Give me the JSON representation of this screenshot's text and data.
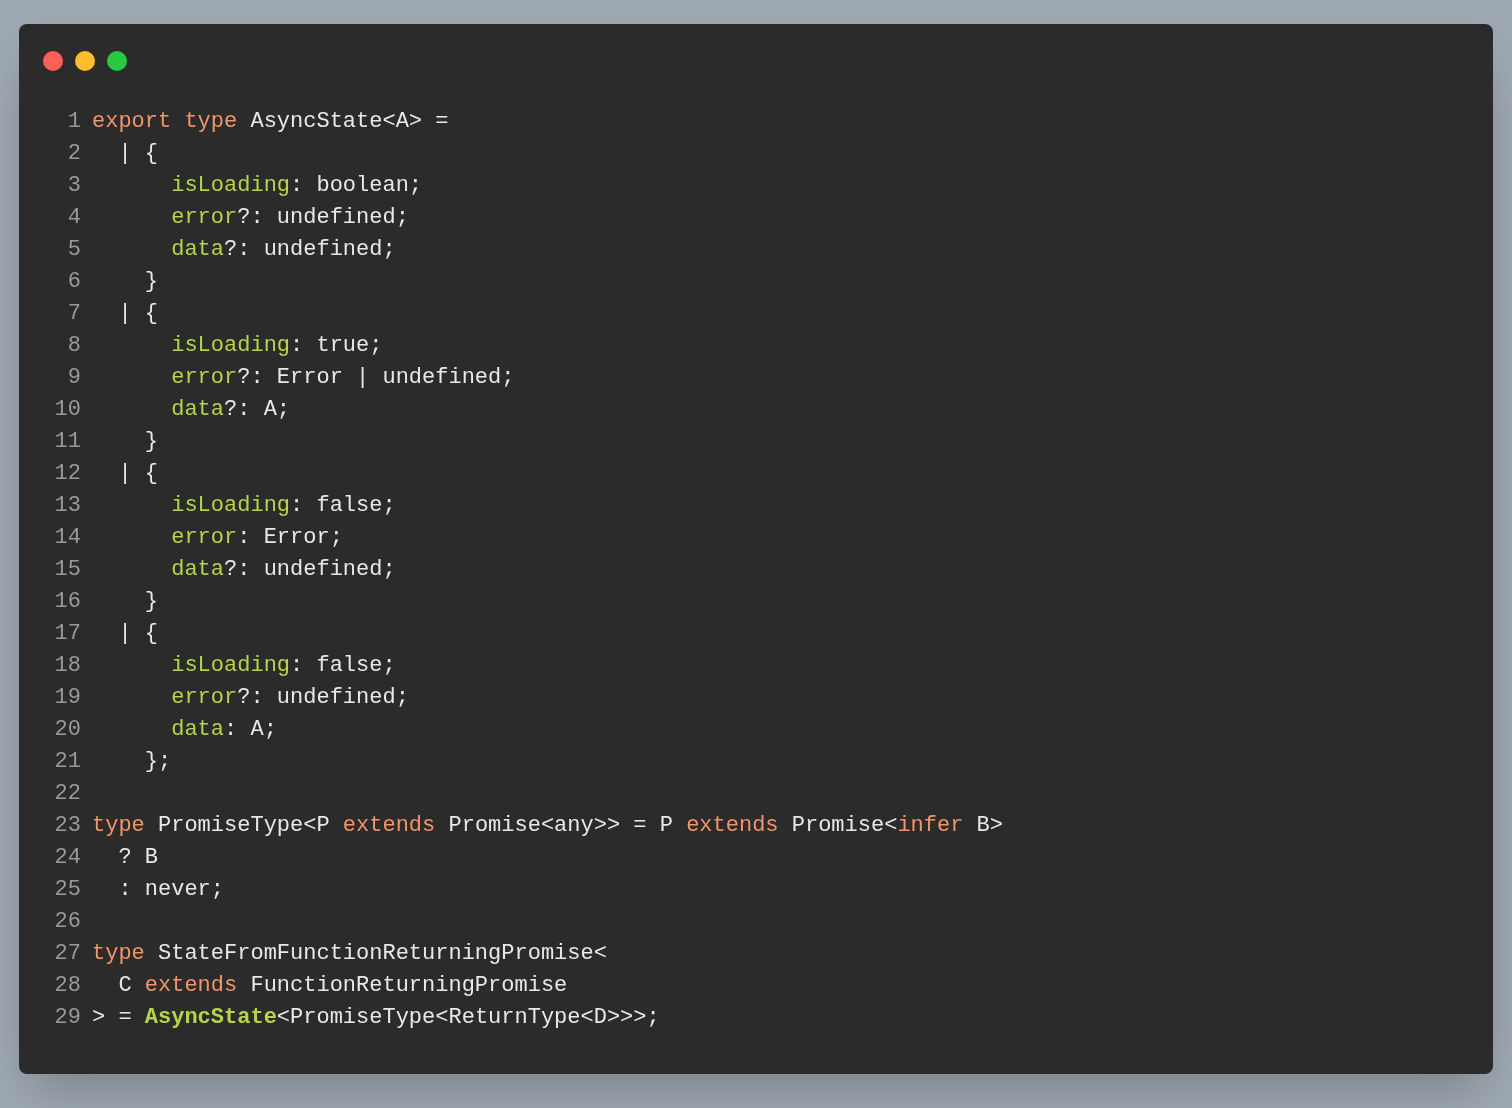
{
  "code": {
    "lines": [
      {
        "number": "1",
        "tokens": [
          {
            "kind": "keyword",
            "text": "export type"
          },
          {
            "kind": "plain",
            "text": " AsyncState<A> ="
          }
        ]
      },
      {
        "number": "2",
        "tokens": [
          {
            "kind": "plain",
            "text": "  | {"
          }
        ]
      },
      {
        "number": "3",
        "tokens": [
          {
            "kind": "property",
            "text": "      isLoading"
          },
          {
            "kind": "plain",
            "text": ": boolean;"
          }
        ]
      },
      {
        "number": "4",
        "tokens": [
          {
            "kind": "property",
            "text": "      error"
          },
          {
            "kind": "plain",
            "text": "?: undefined;"
          }
        ]
      },
      {
        "number": "5",
        "tokens": [
          {
            "kind": "property",
            "text": "      data"
          },
          {
            "kind": "plain",
            "text": "?: undefined;"
          }
        ]
      },
      {
        "number": "6",
        "tokens": [
          {
            "kind": "plain",
            "text": "    }"
          }
        ]
      },
      {
        "number": "7",
        "tokens": [
          {
            "kind": "plain",
            "text": "  | {"
          }
        ]
      },
      {
        "number": "8",
        "tokens": [
          {
            "kind": "property",
            "text": "      isLoading"
          },
          {
            "kind": "plain",
            "text": ": true;"
          }
        ]
      },
      {
        "number": "9",
        "tokens": [
          {
            "kind": "property",
            "text": "      error"
          },
          {
            "kind": "plain",
            "text": "?: Error | undefined;"
          }
        ]
      },
      {
        "number": "10",
        "tokens": [
          {
            "kind": "property",
            "text": "      data"
          },
          {
            "kind": "plain",
            "text": "?: A;"
          }
        ]
      },
      {
        "number": "11",
        "tokens": [
          {
            "kind": "plain",
            "text": "    }"
          }
        ]
      },
      {
        "number": "12",
        "tokens": [
          {
            "kind": "plain",
            "text": "  | {"
          }
        ]
      },
      {
        "number": "13",
        "tokens": [
          {
            "kind": "property",
            "text": "      isLoading"
          },
          {
            "kind": "plain",
            "text": ": false;"
          }
        ]
      },
      {
        "number": "14",
        "tokens": [
          {
            "kind": "property",
            "text": "      error"
          },
          {
            "kind": "plain",
            "text": ": Error;"
          }
        ]
      },
      {
        "number": "15",
        "tokens": [
          {
            "kind": "property",
            "text": "      data"
          },
          {
            "kind": "plain",
            "text": "?: undefined;"
          }
        ]
      },
      {
        "number": "16",
        "tokens": [
          {
            "kind": "plain",
            "text": "    }"
          }
        ]
      },
      {
        "number": "17",
        "tokens": [
          {
            "kind": "plain",
            "text": "  | {"
          }
        ]
      },
      {
        "number": "18",
        "tokens": [
          {
            "kind": "property",
            "text": "      isLoading"
          },
          {
            "kind": "plain",
            "text": ": false;"
          }
        ]
      },
      {
        "number": "19",
        "tokens": [
          {
            "kind": "property",
            "text": "      error"
          },
          {
            "kind": "plain",
            "text": "?: undefined;"
          }
        ]
      },
      {
        "number": "20",
        "tokens": [
          {
            "kind": "property",
            "text": "      data"
          },
          {
            "kind": "plain",
            "text": ": A;"
          }
        ]
      },
      {
        "number": "21",
        "tokens": [
          {
            "kind": "plain",
            "text": "    };"
          }
        ]
      },
      {
        "number": "22"
      },
      {
        "number": "23",
        "tokens": [
          {
            "kind": "keyword",
            "text": "type"
          },
          {
            "kind": "plain",
            "text": " PromiseType<P "
          },
          {
            "kind": "keyword",
            "text": "extends"
          },
          {
            "kind": "plain",
            "text": " Promise<any>> = P "
          },
          {
            "kind": "keyword",
            "text": "extends"
          },
          {
            "kind": "plain",
            "text": " Promise<"
          },
          {
            "kind": "keyword",
            "text": "infer"
          },
          {
            "kind": "plain",
            "text": " B>"
          }
        ]
      },
      {
        "number": "24",
        "tokens": [
          {
            "kind": "plain",
            "text": "  ? B"
          }
        ]
      },
      {
        "number": "25",
        "tokens": [
          {
            "kind": "plain",
            "text": "  : never;"
          }
        ]
      },
      {
        "number": "26"
      },
      {
        "number": "27",
        "tokens": [
          {
            "kind": "keyword",
            "text": "type"
          },
          {
            "kind": "plain",
            "text": " StateFromFunctionReturningPromise<"
          }
        ]
      },
      {
        "number": "28",
        "tokens": [
          {
            "kind": "plain",
            "text": "  C "
          },
          {
            "kind": "keyword",
            "text": "extends"
          },
          {
            "kind": "plain",
            "text": " FunctionReturningPromise"
          }
        ]
      },
      {
        "number": "29",
        "tokens": [
          {
            "kind": "plain",
            "text": "> = "
          },
          {
            "kind": "type",
            "text": "AsyncState"
          },
          {
            "kind": "plain",
            "text": "<PromiseType<ReturnType<D>>>;"
          }
        ]
      }
    ]
  }
}
